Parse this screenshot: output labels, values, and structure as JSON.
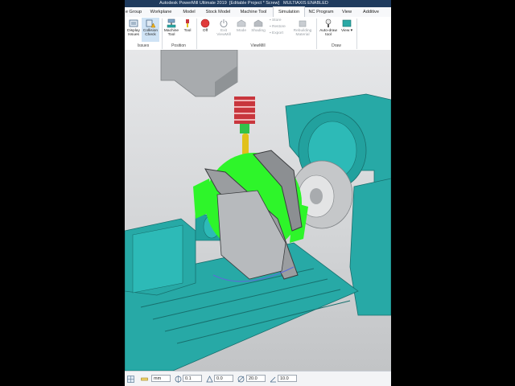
{
  "window": {
    "title_left": "Autodesk PowerMill Ultimate 2019",
    "title_project": "[Editable Project * Screw]",
    "title_right": "MULTIAXIS ENABLED"
  },
  "ribbon_tabs": [
    {
      "label": "e Group"
    },
    {
      "label": "Workplane"
    },
    {
      "label": "Model"
    },
    {
      "label": "Stock Model"
    },
    {
      "label": "Machine Tool"
    },
    {
      "label": "Simulation",
      "active": true
    },
    {
      "label": "NC Program"
    },
    {
      "label": "View"
    },
    {
      "label": "Additive"
    }
  ],
  "ribbon": {
    "display_issues": "Display Issues",
    "collision_check": "Collision Check",
    "issues_group": "Issues",
    "machine_tool": "Machine Tool",
    "tool": "Tool",
    "position_group": "Position",
    "off": "Off",
    "exit_viewmill": "Exit ViewMill",
    "mode": "Mode",
    "shading": "Shading",
    "store": "Store",
    "restore": "Restore",
    "export": "Export",
    "rebuild_material": "Rebuilding Material",
    "viewmill_group": "ViewMill",
    "auto_draw_tool": "Auto-draw tool",
    "view": "View",
    "draw_group": "Draw"
  },
  "statusbar": {
    "units": "mm",
    "tolerance": "0.1",
    "offset": "0.0",
    "diameter": "20.0",
    "angle": "10.0"
  },
  "colors": {
    "machine_cyan": "#27a9a6",
    "stock_green": "#2ef52a",
    "tool_red": "#c8363d",
    "tool_yellow": "#e1c11a",
    "stop_red": "#e03a3a"
  }
}
